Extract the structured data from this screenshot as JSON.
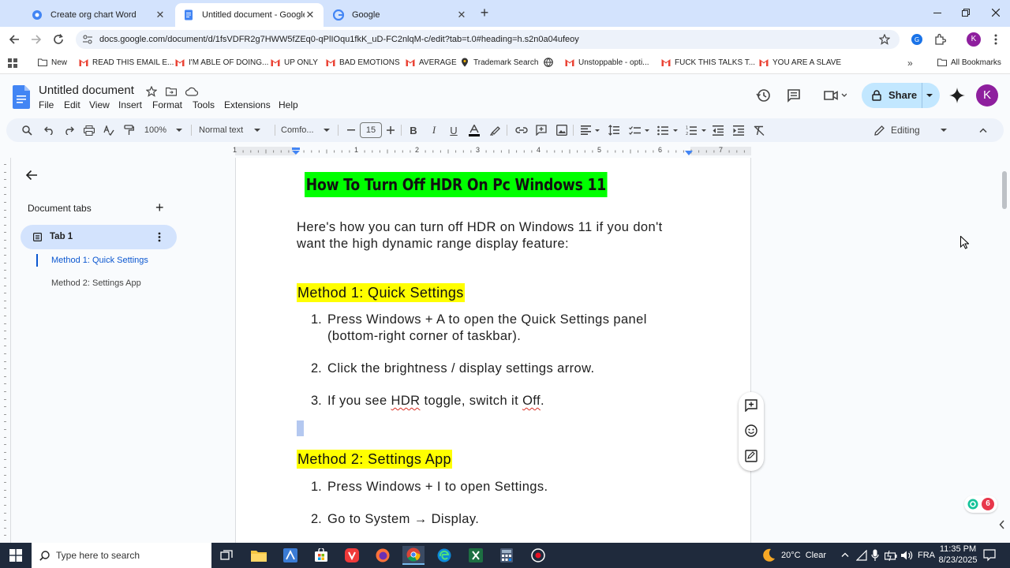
{
  "browser": {
    "tabs": [
      {
        "title": "Create org chart Word",
        "active": false
      },
      {
        "title": "Untitled document - Google Do",
        "active": true
      },
      {
        "title": "Google",
        "active": false
      }
    ],
    "url": "docs.google.com/document/d/1fsVDFR2g7HWW5fZEq0-qPlIOqu1fkK_uD-FC2nlqM-c/edit?tab=t.0#heading=h.s2n0a04ufeoy",
    "bookmarks": [
      {
        "label": "New",
        "icon": "folder-icon"
      },
      {
        "label": "READ THIS EMAIL E...",
        "icon": "gmail-icon"
      },
      {
        "label": "I'M ABLE OF DOING...",
        "icon": "gmail-icon"
      },
      {
        "label": "UP ONLY",
        "icon": "gmail-icon"
      },
      {
        "label": "BAD EMOTIONS",
        "icon": "gmail-icon"
      },
      {
        "label": "AVERAGE",
        "icon": "gmail-icon"
      },
      {
        "label": "Trademark Search",
        "icon": "pin-icon"
      },
      {
        "label": "",
        "icon": "globe-icon"
      },
      {
        "label": "Unstoppable - opti...",
        "icon": "gmail-icon"
      },
      {
        "label": "FUCK THIS TALKS T...",
        "icon": "gmail-icon"
      },
      {
        "label": "YOU ARE A SLAVE",
        "icon": "gmail-icon"
      }
    ],
    "all_bookmarks": "All Bookmarks",
    "profile_initial": "K"
  },
  "docs": {
    "title": "Untitled document",
    "menus": [
      "File",
      "Edit",
      "View",
      "Insert",
      "Format",
      "Tools",
      "Extensions",
      "Help"
    ],
    "share_label": "Share",
    "avatar_initial": "K",
    "toolbar": {
      "zoom": "100%",
      "style": "Normal text",
      "font": "Comfo...",
      "font_size": "15",
      "mode": "Editing"
    },
    "ruler_numbers": [
      "1",
      "1",
      "2",
      "3",
      "4",
      "5",
      "6",
      "7"
    ]
  },
  "sidebar": {
    "section_title": "Document tabs",
    "tab_name": "Tab 1",
    "headings": [
      "Method 1: Quick Settings",
      "Method 2: Settings App"
    ]
  },
  "document": {
    "title": "How To Turn Off HDR On Pc Windows 11",
    "intro_line1": "Here's how you can turn off HDR on Windows 11 if you don't",
    "intro_line2": "want the high dynamic range display feature:",
    "method1": {
      "heading": "Method 1: Quick Settings",
      "steps": [
        {
          "num": "1.",
          "line1": "Press Windows + A to open the Quick Settings panel",
          "line2": "(bottom-right corner of taskbar)."
        },
        {
          "num": "2.",
          "line1": "Click the brightness / display settings arrow."
        },
        {
          "num": "3.",
          "pre": "If you see ",
          "hdr": "HDR",
          "mid": " toggle, switch it ",
          "off": "Off",
          "post": "."
        }
      ]
    },
    "method2": {
      "heading": "Method 2: Settings App",
      "steps": [
        {
          "num": "1.",
          "line1": "Press Windows + I to open Settings."
        },
        {
          "num": "2.",
          "line1": "Go to System → Display."
        }
      ]
    }
  },
  "notification_count": "6",
  "taskbar": {
    "search_placeholder": "Type here to search",
    "weather": "20°C  Clear",
    "language": "FRA",
    "time": "11:35 PM",
    "date": "8/23/2025"
  },
  "colors": {
    "title_highlight": "#00ff00",
    "heading_highlight": "#ffff00",
    "share_bg": "#c2e7ff",
    "sidebar_active": "#d3e3fd",
    "tabstrip": "#d3e3fd",
    "avatar": "#8e1f9e",
    "taskbar": "#1f2a3c"
  }
}
